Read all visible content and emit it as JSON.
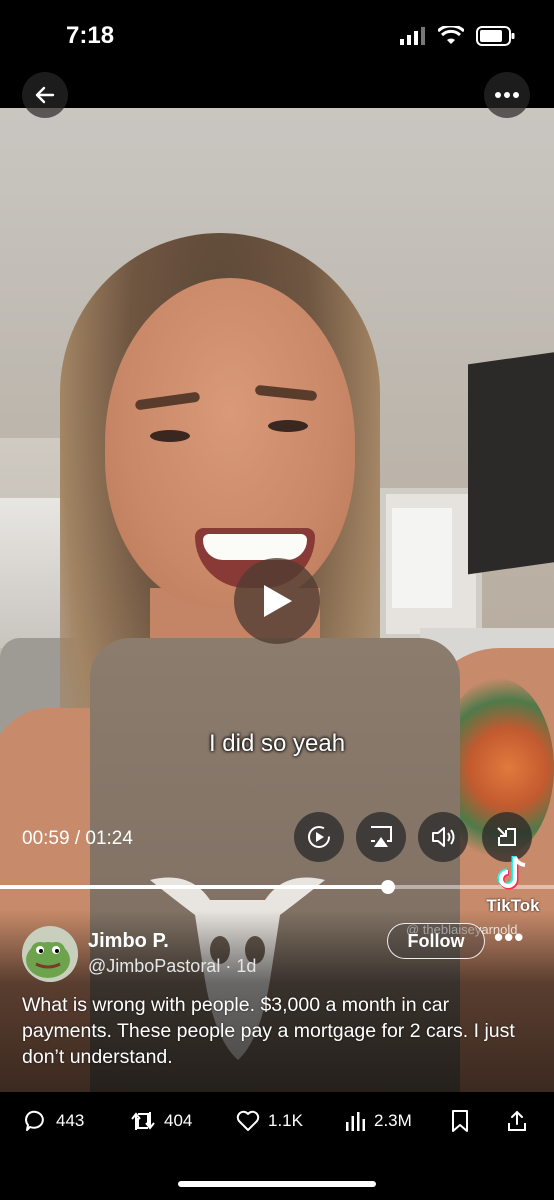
{
  "status_bar": {
    "time": "7:18"
  },
  "nav": {
    "back_icon": "arrow-left-icon",
    "more_icon": "ellipsis-icon"
  },
  "video": {
    "caption": "I did so yeah",
    "elapsed": "00:59",
    "separator": "/",
    "duration": "01:24",
    "time_display": "00:59 / 01:24",
    "progress_fraction": 0.7,
    "watermark_brand": "TikTok",
    "watermark_handle": "@ theblaiseyarnold",
    "controls": [
      "replay-icon",
      "airplay-icon",
      "volume-icon",
      "exit-fullscreen-icon"
    ]
  },
  "post": {
    "display_name": "Jimbo P.",
    "handle": "@JimboPastoral",
    "age": "1d",
    "handle_line": "@JimboPastoral · 1d",
    "follow_label": "Follow",
    "more_label": "•••",
    "text": "What is wrong with people.  $3,000 a month in car payments.  These people pay a mortgage for 2 cars. I just don’t understand."
  },
  "actions": {
    "replies": "443",
    "reposts": "404",
    "likes": "1.1K",
    "views": "2.3M"
  },
  "colors": {
    "background": "#000000",
    "text": "#ffffff"
  }
}
